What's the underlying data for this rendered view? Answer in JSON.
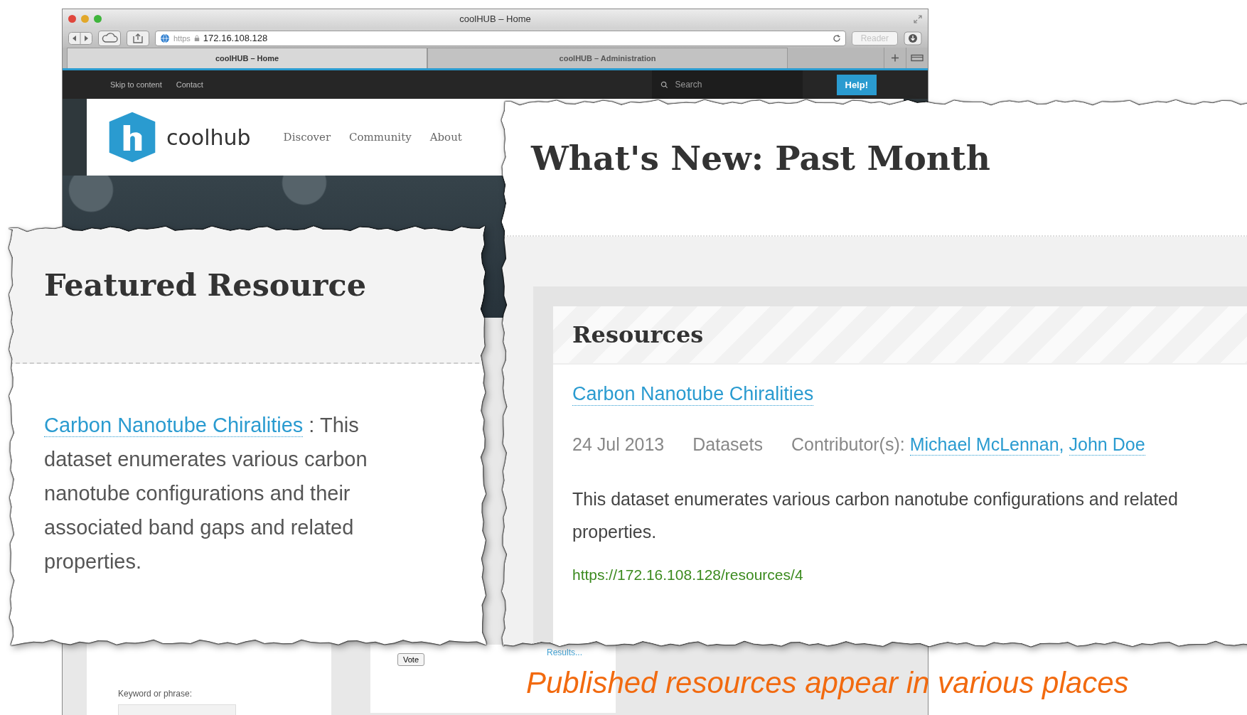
{
  "window": {
    "title": "coolHUB – Home"
  },
  "toolbar": {
    "scheme": "https",
    "url": "172.16.108.128",
    "reader": {
      "label": "Reader",
      "disabled": true
    }
  },
  "tabs": [
    {
      "label": "coolHUB – Home",
      "selected": true
    },
    {
      "label": "coolHUB – Administration",
      "selected": false
    }
  ],
  "site": {
    "top_links": [
      "Skip to content",
      "Contact"
    ],
    "search": {
      "placeholder": "Search"
    },
    "help_button": "Help!",
    "logo_text": "coolhub",
    "nav": [
      "Discover",
      "Community",
      "About"
    ],
    "search_form": {
      "label": "Keyword or phrase:"
    },
    "poll": {
      "vote_button": "Vote",
      "results_link": "Results..."
    }
  },
  "featured": {
    "title": "Featured Resource",
    "link": "Carbon Nanotube Chiralities",
    "text": " : This dataset enumerates various carbon nanotube configurations and their associated band gaps and related properties."
  },
  "whats_new": {
    "title": "What's New: Past Month",
    "section": "Resources",
    "resource": {
      "title": "Carbon Nanotube Chiralities",
      "date": "24 Jul 2013",
      "type": "Datasets",
      "contributors_label": "Contributor(s):",
      "contributors": [
        "Michael McLennan",
        "John Doe"
      ],
      "separator": ",",
      "description": "This dataset enumerates various carbon nanotube configurations and related properties.",
      "url": "https://172.16.108.128/resources/4"
    }
  },
  "caption": "Published resources appear in various places"
}
